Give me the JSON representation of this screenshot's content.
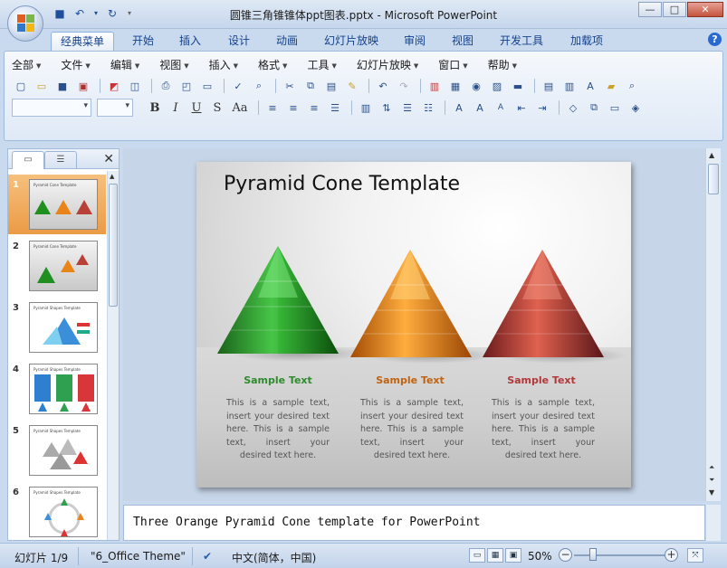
{
  "window": {
    "title": "圆锥三角锥锥体ppt图表.pptx - Microsoft PowerPoint",
    "min": "—",
    "max": "□",
    "close": "✕"
  },
  "ribbon_tabs": [
    "经典菜单",
    "开始",
    "插入",
    "设计",
    "动画",
    "幻灯片放映",
    "审阅",
    "视图",
    "开发工具",
    "加载项"
  ],
  "active_tab": "经典菜单",
  "help": "?",
  "menu": [
    "全部",
    "文件",
    "编辑",
    "视图",
    "插入",
    "格式",
    "工具",
    "幻灯片放映",
    "窗口",
    "帮助"
  ],
  "format_buttons": [
    "B",
    "I",
    "U",
    "S",
    "Aa"
  ],
  "pane": {
    "close": "✕",
    "slides": [
      {
        "num": "1",
        "title": "Pyramid Cone Template"
      },
      {
        "num": "2",
        "title": "Pyramid Cone Template"
      },
      {
        "num": "3",
        "title": "Pyramid Shapes Template"
      },
      {
        "num": "4",
        "title": "Pyramid Shapes Template"
      },
      {
        "num": "5",
        "title": "Pyramid Shapes Template"
      },
      {
        "num": "6",
        "title": "Pyramid Shapes Template"
      }
    ]
  },
  "slide": {
    "title": "Pyramid Cone Template",
    "columns": [
      {
        "heading": "Sample Text",
        "color": "#2e8b2e",
        "body": "This is a sample text, insert your desired text here. This is a sample text, insert your desired text here."
      },
      {
        "heading": "Sample Text",
        "color": "#c0620f",
        "body": "This is a sample text, insert your desired text here. This is a sample text, insert your desired text here."
      },
      {
        "heading": "Sample Text",
        "color": "#b2373a",
        "body": "This is a sample text, insert your desired text here. This is a sample text, insert your desired text here."
      }
    ]
  },
  "notes": "Three Orange Pyramid Cone template for PowerPoint",
  "status": {
    "slide_counter": "幻灯片 1/9",
    "theme": "\"6_Office Theme\"",
    "language": "中文(简体，中国)",
    "zoom": "50%",
    "zoom_minus": "−",
    "zoom_plus": "+"
  },
  "colors": {
    "green": [
      "#0f5f0f",
      "#2aa02a",
      "#6be36b"
    ],
    "orange": [
      "#a84d05",
      "#ef8a1c",
      "#ffc266"
    ],
    "red": [
      "#6e1a1c",
      "#c4443c",
      "#f08a78"
    ]
  }
}
